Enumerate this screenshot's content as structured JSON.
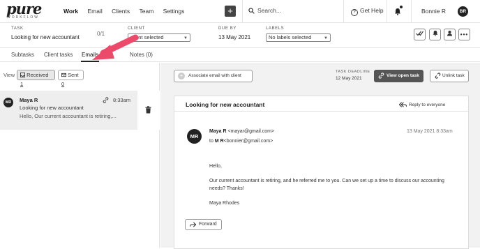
{
  "brand": {
    "logo_word": "pure",
    "logo_sub": "WORKFLOW"
  },
  "nav": {
    "links": [
      "Work",
      "Email",
      "Clients",
      "Team",
      "Settings"
    ],
    "active": "Work",
    "search_placeholder": "Search...",
    "help_label": "Get Help",
    "user_name": "Bonnie R",
    "user_initials": "BR"
  },
  "task": {
    "task_label": "TASK",
    "task_value": "Looking for new accountant",
    "progress": "0/1",
    "client_label": "CLIENT",
    "client_value": "client selected",
    "due_label": "DUE BY",
    "due_value": "13 May 2021",
    "labels_label": "LABELS",
    "labels_value": "No labels selected"
  },
  "tabs": [
    {
      "label": "Subtasks",
      "active": false
    },
    {
      "label": "Client tasks",
      "active": false
    },
    {
      "label": "Emails",
      "active": true
    },
    {
      "label": "Notes (0)",
      "active": false
    }
  ],
  "filter": {
    "view_label": "View",
    "received_label": "Received",
    "received_count": "1",
    "sent_label": "Sent",
    "sent_count": "0"
  },
  "email_list": [
    {
      "initials": "MR",
      "from": "Maya R",
      "time": "8:33am",
      "subject": "Looking for new accountant",
      "preview": "Hello, Our current accountant is retiring,..."
    }
  ],
  "actions": {
    "associate": "Associate email with client",
    "deadline_label": "TASK DEADLINE",
    "deadline_value": "12 May 2021",
    "view_open": "View open task",
    "unlink": "Unlink task"
  },
  "email_view": {
    "title": "Looking for new accountant",
    "reply_all": "Reply to everyone",
    "avatar": "MR",
    "from_name": "Maya R",
    "from_email": "<mayar@gmail.com>",
    "to_prefix": "to",
    "to_name": "M R",
    "to_email": "<bonnier@gmail.com>",
    "date": "13 May 2021 8:33am",
    "body": [
      "Hello,",
      "Our current accountant is retiring, and he referred me to you. Can we set up a time to discuss our accounting",
      "needs? Thanks!",
      "Maya Rhodes"
    ],
    "forward": "Forward"
  },
  "colors": {
    "annotation_arrow": "#ec4a6a",
    "primary_button": "#555555"
  }
}
